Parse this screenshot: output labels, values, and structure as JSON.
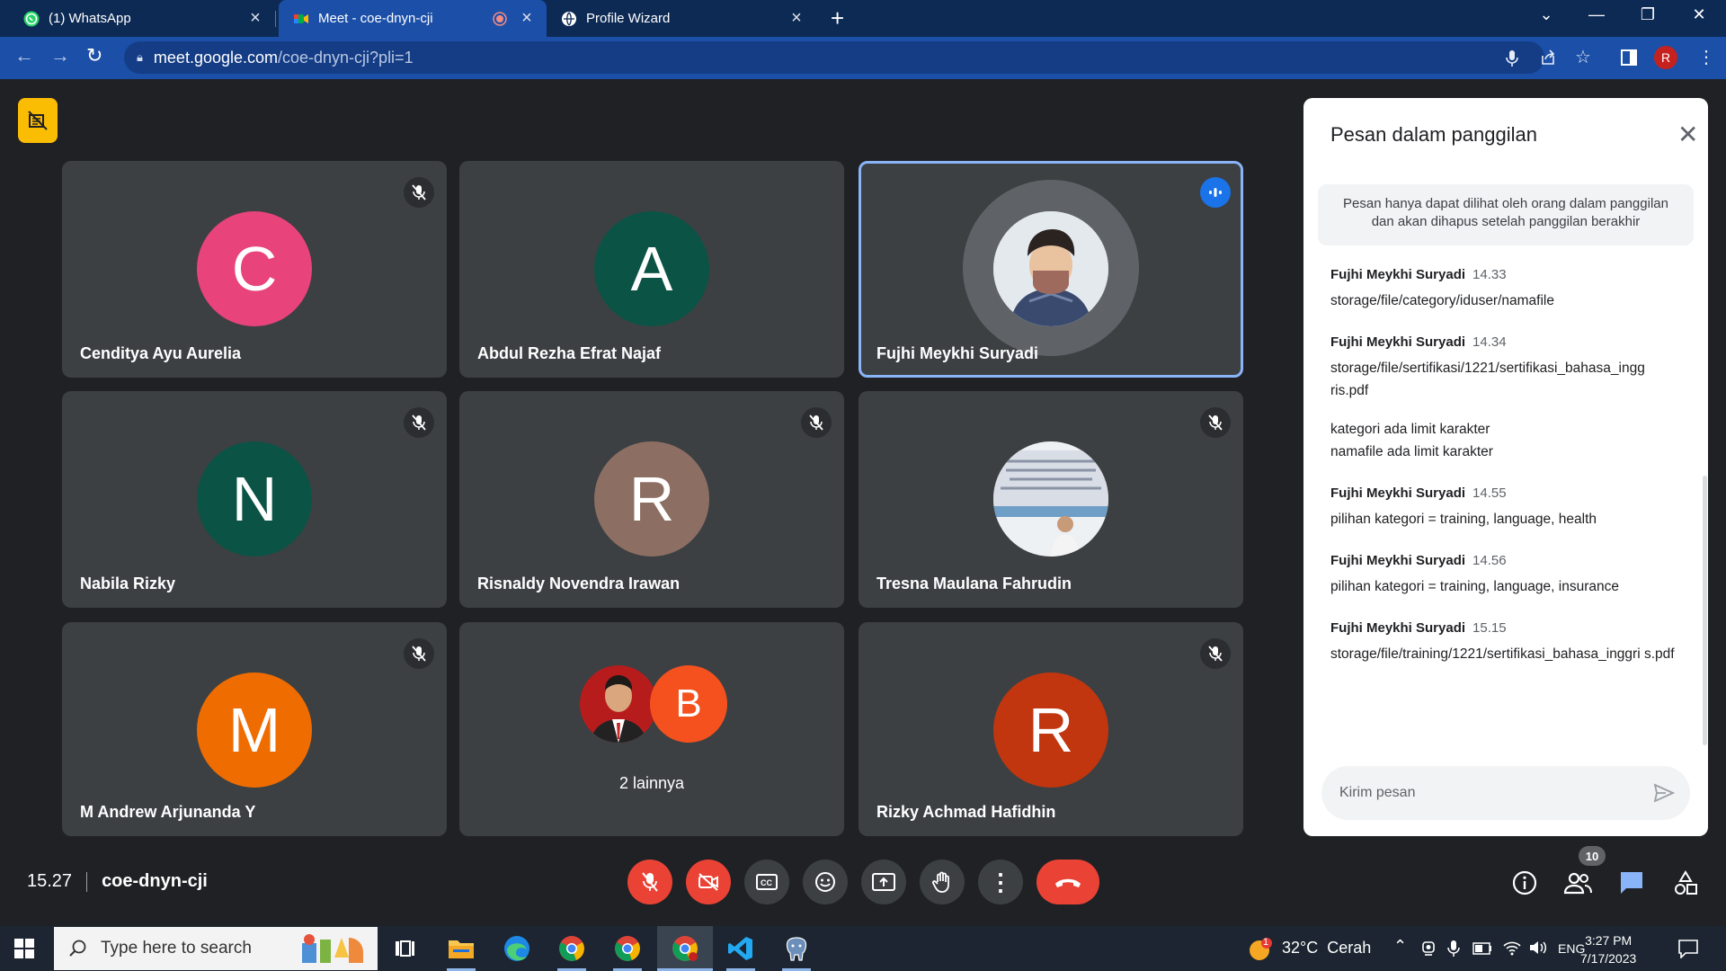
{
  "browser": {
    "tabs": [
      {
        "title": "(1) WhatsApp",
        "icon": "whatsapp-icon"
      },
      {
        "title": "Meet - coe-dnyn-cji",
        "icon": "google-meet-icon",
        "recording": true
      },
      {
        "title": "Profile Wizard",
        "icon": "globe-icon"
      }
    ],
    "url_host": "meet.google.com",
    "url_path": "/coe-dnyn-cji?pli=1",
    "profile_initial": "R"
  },
  "participants": [
    {
      "name": "Cenditya Ayu Aurelia",
      "initial": "C",
      "color": "#e8437a",
      "muted": true
    },
    {
      "name": "Abdul Rezha Efrat Najaf",
      "initial": "A",
      "color": "#0b5345",
      "muted": false
    },
    {
      "name": "Fujhi Meykhi Suryadi",
      "initial": "",
      "color": "#5f6368",
      "muted": false,
      "speaking": true,
      "photo": true
    },
    {
      "name": "Nabila Rizky",
      "initial": "N",
      "color": "#0b5345",
      "muted": true
    },
    {
      "name": "Risnaldy Novendra Irawan",
      "initial": "R",
      "color": "#8d6e63",
      "muted": true
    },
    {
      "name": "Tresna Maulana Fahrudin",
      "initial": "",
      "color": "#ccc",
      "muted": true,
      "photo": true
    },
    {
      "name": "M Andrew Arjunanda Y",
      "initial": "M",
      "color": "#ef6c00",
      "muted": true
    },
    {
      "name": "2 lainnya",
      "initial": "B",
      "color": "#f4511e",
      "muted": false,
      "others": true
    },
    {
      "name": "Rizky Achmad Hafidhin",
      "initial": "R",
      "color": "#c1360f",
      "muted": true
    }
  ],
  "chat": {
    "title": "Pesan dalam panggilan",
    "notice": "Pesan hanya dapat dilihat oleh orang dalam panggilan dan akan dihapus setelah panggilan berakhir",
    "messages": [
      {
        "sender": "Fujhi Meykhi Suryadi",
        "time": "14.33",
        "lines": [
          "storage/file/category/iduser/namafile"
        ]
      },
      {
        "sender": "Fujhi Meykhi Suryadi",
        "time": "14.34",
        "lines": [
          "storage/file/sertifikasi/1221/sertifikasi_bahasa_ingg ris.pdf"
        ],
        "extra": [
          "kategori ada limit karakter",
          "namafile ada limit karakter"
        ]
      },
      {
        "sender": "Fujhi Meykhi Suryadi",
        "time": "14.55",
        "lines": [
          "pilihan kategori = training, language, health"
        ]
      },
      {
        "sender": "Fujhi Meykhi Suryadi",
        "time": "14.56",
        "lines": [
          "pilihan kategori = training, language, insurance"
        ]
      },
      {
        "sender": "Fujhi Meykhi Suryadi",
        "time": "15.15",
        "lines": [
          "storage/file/training/1221/sertifikasi_bahasa_inggri s.pdf"
        ]
      }
    ],
    "input_placeholder": "Kirim pesan"
  },
  "meeting": {
    "time": "15.27",
    "code": "coe-dnyn-cji",
    "people_count": "10"
  },
  "taskbar": {
    "search_placeholder": "Type here to search",
    "weather": "32°C  Cerah",
    "weather_badge": "1",
    "lang": "ENG",
    "time": "3:27 PM",
    "date": "7/17/2023"
  }
}
